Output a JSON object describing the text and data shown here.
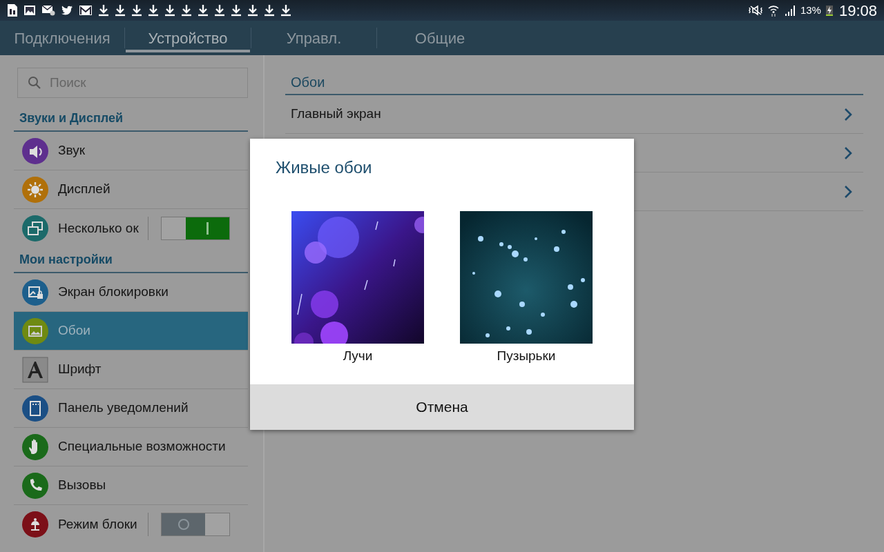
{
  "status_bar": {
    "battery": "13%",
    "time": "19:08"
  },
  "tabs": [
    {
      "label": "Подключения",
      "selected": false
    },
    {
      "label": "Устройство",
      "selected": true
    },
    {
      "label": "Управл.",
      "selected": false
    },
    {
      "label": "Общие",
      "selected": false
    }
  ],
  "search": {
    "placeholder": "Поиск"
  },
  "sections": [
    {
      "title": "Звуки и Дисплей",
      "items": [
        {
          "label": "Звук",
          "color": "#5e2f8e",
          "selected": false
        },
        {
          "label": "Дисплей",
          "color": "#b0700a",
          "selected": false
        },
        {
          "label": "Несколько ок",
          "color": "#1c6a6a",
          "selected": false,
          "kind": "toggle",
          "on": true
        }
      ]
    },
    {
      "title": "Мои настройки",
      "items": [
        {
          "label": "Экран блокировки",
          "color": "#1d5f8c",
          "selected": false
        },
        {
          "label": "Обои",
          "color": "#6f8a12",
          "selected": true
        },
        {
          "label": "Шрифт",
          "color": "#8a8a8a",
          "selected": false,
          "kind": "square"
        },
        {
          "label": "Панель уведомлений",
          "color": "#1b4f85",
          "selected": false
        },
        {
          "label": "Специальные возможности",
          "color": "#1a6a1a",
          "selected": false
        },
        {
          "label": "Вызовы",
          "color": "#1a6a1a",
          "selected": false
        },
        {
          "label": "Режим блоки",
          "color": "#7c1018",
          "selected": false,
          "kind": "toggle",
          "on": false
        }
      ]
    }
  ],
  "detail": {
    "title": "Обои",
    "rows": [
      {
        "label": "Главный экран"
      },
      {},
      {}
    ]
  },
  "dialog": {
    "title": "Живые обои",
    "options": [
      {
        "label": "Лучи",
        "kind": "picture"
      },
      {
        "label": "Пузырьки",
        "kind": "picture"
      }
    ],
    "button": "Отмена"
  }
}
